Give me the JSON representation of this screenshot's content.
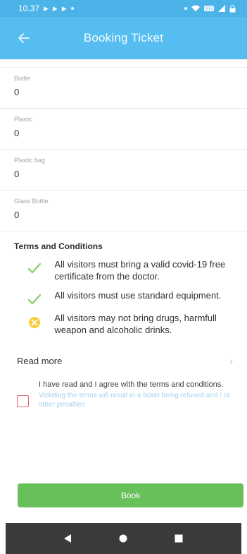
{
  "status_bar": {
    "time": "10.37"
  },
  "app_bar": {
    "title": "Booking Ticket"
  },
  "fields": [
    {
      "label": "Bottle",
      "value": "0"
    },
    {
      "label": "Plastic",
      "value": "0"
    },
    {
      "label": "Plastic bag",
      "value": "0"
    },
    {
      "label": "Glass Bottle",
      "value": "0"
    }
  ],
  "terms": {
    "title": "Terms and Conditions",
    "items": [
      {
        "icon": "check-icon",
        "text": "All visitors must bring a valid covid-19 free certificate from the doctor."
      },
      {
        "icon": "check-icon",
        "text": "All visitors must use standard equipment."
      },
      {
        "icon": "prohibited-icon",
        "text": "All visitors may not bring drugs, harmfull weapon and alcoholic drinks."
      }
    ]
  },
  "read_more": {
    "label": "Read more"
  },
  "agree": {
    "text": "I have read and I agree with the terms and conditions.",
    "note": "Violating the terms will result in a ticket being refused and / or other penalties"
  },
  "book_button": {
    "label": "Book"
  },
  "colors": {
    "primary": "#55bdf0",
    "accent_green": "#68c05b",
    "check_icon": "#8fd16f",
    "prohibited_icon": "#f6cf3a",
    "checkbox_border": "#e2687a"
  }
}
